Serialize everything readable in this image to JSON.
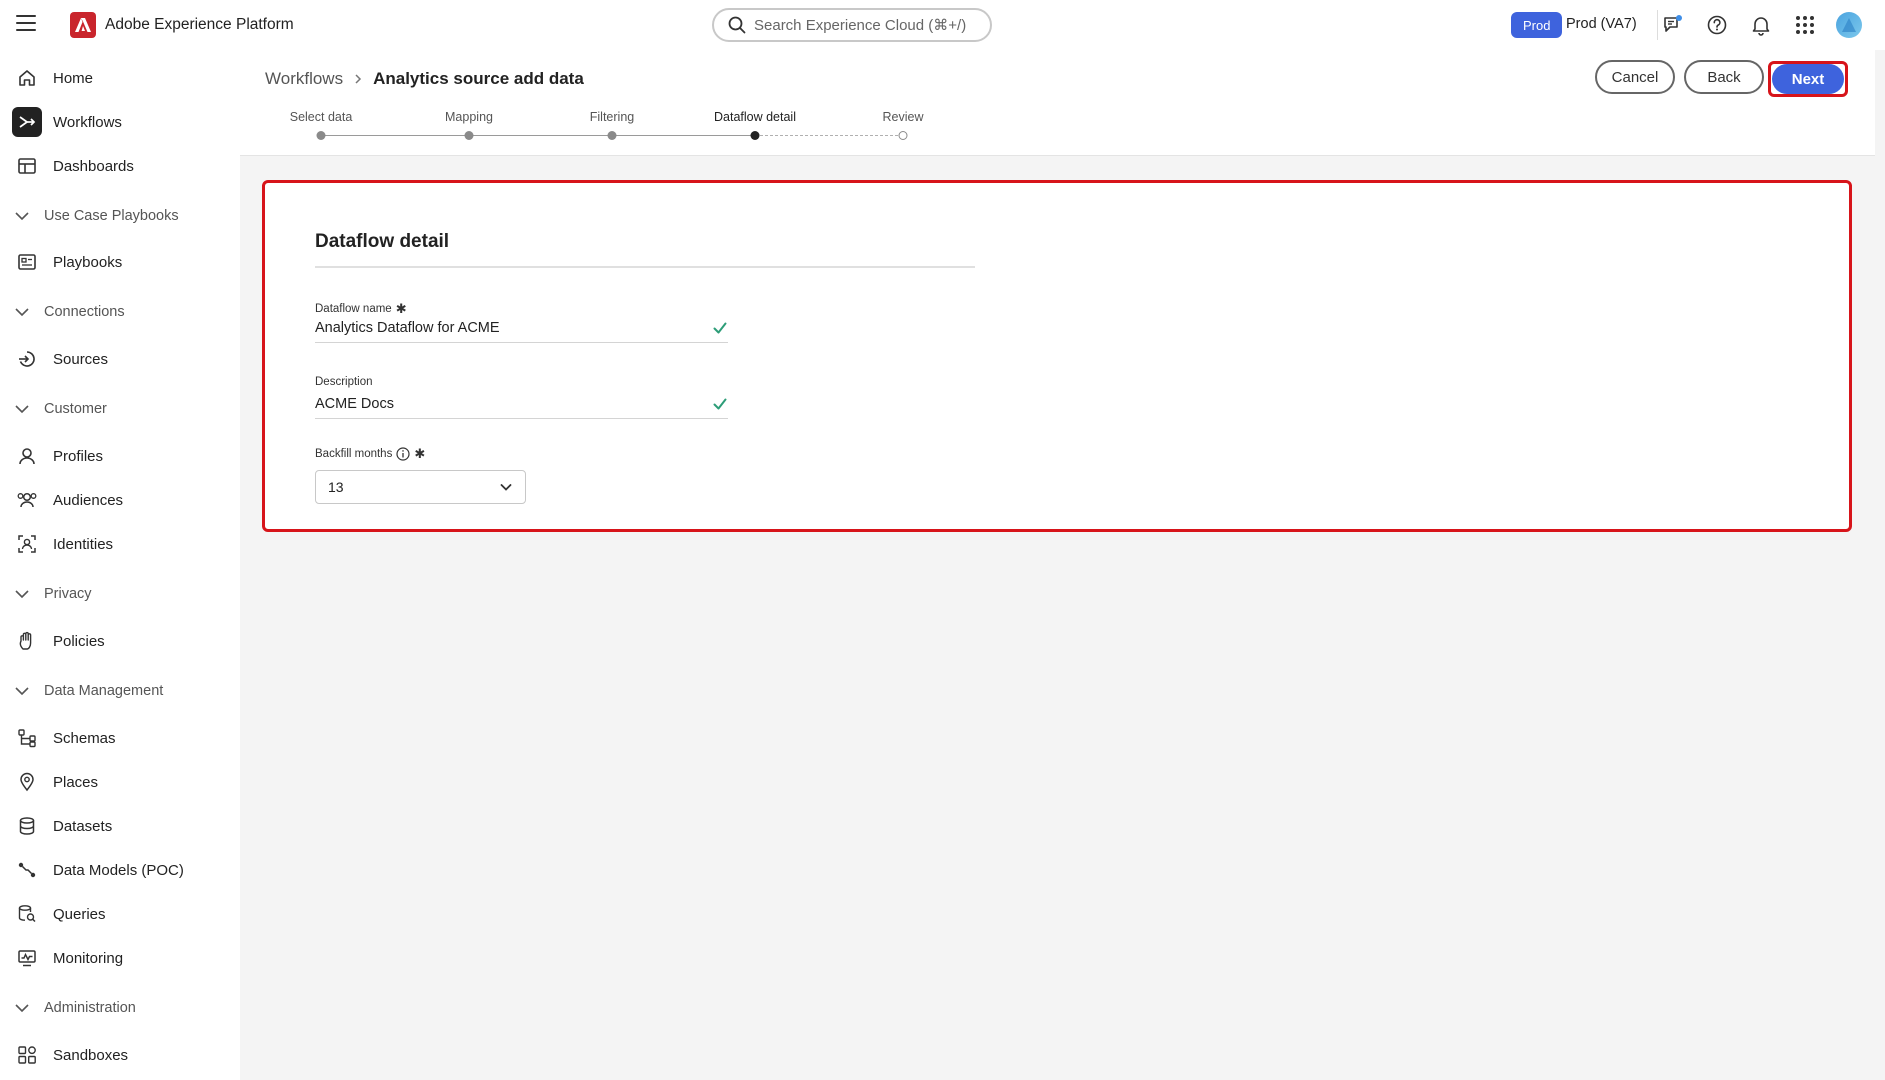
{
  "app": {
    "title": "Adobe Experience Platform"
  },
  "search": {
    "placeholder": "Search Experience Cloud (⌘+/)"
  },
  "environment": {
    "badge": "Prod",
    "label": "Prod (VA7)"
  },
  "sidebar": {
    "items": [
      {
        "label": "Home",
        "icon": "home-icon"
      },
      {
        "label": "Workflows",
        "icon": "workflows-icon",
        "active": true
      },
      {
        "label": "Dashboards",
        "icon": "dashboards-icon"
      }
    ],
    "sections": {
      "use_case_playbooks": {
        "label": "Use Case Playbooks",
        "items": [
          {
            "label": "Playbooks",
            "icon": "playbooks-icon"
          }
        ]
      },
      "connections": {
        "label": "Connections",
        "items": [
          {
            "label": "Sources",
            "icon": "sources-icon"
          }
        ]
      },
      "customer": {
        "label": "Customer",
        "items": [
          {
            "label": "Profiles",
            "icon": "profiles-icon"
          },
          {
            "label": "Audiences",
            "icon": "audiences-icon"
          },
          {
            "label": "Identities",
            "icon": "identities-icon"
          }
        ]
      },
      "privacy": {
        "label": "Privacy",
        "items": [
          {
            "label": "Policies",
            "icon": "policies-icon"
          }
        ]
      },
      "data_management": {
        "label": "Data Management",
        "items": [
          {
            "label": "Schemas",
            "icon": "schemas-icon"
          },
          {
            "label": "Places",
            "icon": "places-icon"
          },
          {
            "label": "Datasets",
            "icon": "datasets-icon"
          },
          {
            "label": "Data Models (POC)",
            "icon": "data-models-icon"
          },
          {
            "label": "Queries",
            "icon": "queries-icon"
          },
          {
            "label": "Monitoring",
            "icon": "monitoring-icon"
          }
        ]
      },
      "administration": {
        "label": "Administration",
        "items": [
          {
            "label": "Sandboxes",
            "icon": "sandboxes-icon"
          }
        ]
      }
    }
  },
  "breadcrumb": {
    "parent": "Workflows",
    "current": "Analytics source add data"
  },
  "actions": {
    "cancel": "Cancel",
    "back": "Back",
    "next": "Next"
  },
  "stepper": {
    "steps": [
      "Select data",
      "Mapping",
      "Filtering",
      "Dataflow detail",
      "Review"
    ],
    "current_step": "Dataflow detail"
  },
  "form": {
    "title": "Dataflow detail",
    "dataflow_name": {
      "label": "Dataflow name",
      "value": "Analytics Dataflow for ACME",
      "required": true
    },
    "description": {
      "label": "Description",
      "value": "ACME Docs"
    },
    "backfill_months": {
      "label": "Backfill months",
      "value": "13",
      "required": true
    }
  },
  "colors": {
    "accent": "#3e63dd",
    "highlight": "#d7141a",
    "valid": "#2d9d78",
    "adobe_red": "#c9252c"
  }
}
